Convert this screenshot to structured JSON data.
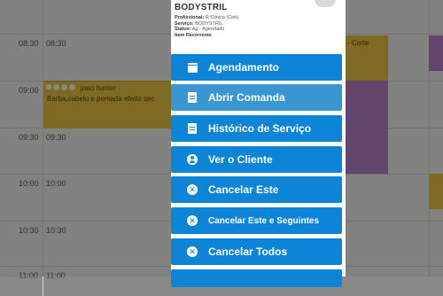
{
  "calendar": {
    "times": [
      "08:30",
      "09:00",
      "09:30",
      "10:00",
      "10:30",
      "11:00"
    ],
    "events": {
      "yellow_left": {
        "title": "joao hunter -",
        "subtitle": "Barba,cabelo e pomada efeito sec"
      },
      "yellow_right": {
        "title": "- Corte"
      },
      "colors": {
        "yellow": "#e6c23f",
        "purple": "#b17fc6"
      }
    }
  },
  "popup": {
    "title": "BODYSTRIL",
    "details": {
      "profissional_label": "Profissional:",
      "profissional_value": "R Clinica (Ceb)",
      "servico_label": "Serviço:",
      "servico_value": "BODYSTRIL",
      "status_label": "Status:",
      "status_value": "Ag - Agendado",
      "recorrente": "Item Recorrente"
    },
    "menu": [
      {
        "label": "Agendamento",
        "icon": "calendar-icon"
      },
      {
        "label": "Abrir Comanda",
        "icon": "clipboard-icon"
      },
      {
        "label": "Histórico de Serviço",
        "icon": "clipboard-icon"
      },
      {
        "label": "Ver o Cliente",
        "icon": "user-circle-icon"
      },
      {
        "label": "Cancelar Este",
        "icon": "x-circle-icon"
      },
      {
        "label": "Cancelar Este e Seguintes",
        "icon": "x-circle-icon"
      },
      {
        "label": "Cancelar Todos",
        "icon": "x-circle-icon"
      }
    ],
    "colors": {
      "button": "#0d84d6",
      "button_alt": "#3a96d1"
    }
  }
}
